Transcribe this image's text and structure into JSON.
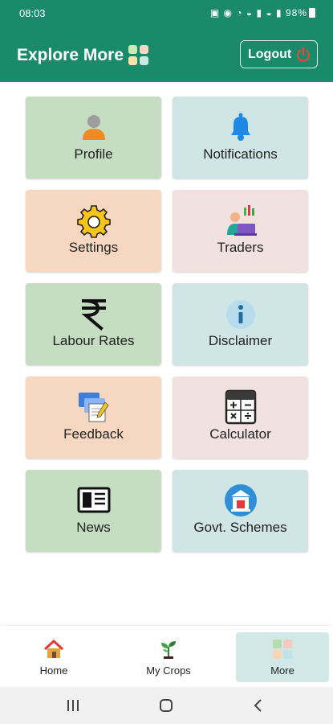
{
  "status": {
    "time": "08:03",
    "battery": "98%"
  },
  "header": {
    "title": "Explore More",
    "logout_label": "Logout"
  },
  "menu": [
    {
      "label": "Profile",
      "icon": "profile-icon"
    },
    {
      "label": "Notifications",
      "icon": "bell-icon"
    },
    {
      "label": "Settings",
      "icon": "gear-icon"
    },
    {
      "label": "Traders",
      "icon": "traders-icon"
    },
    {
      "label": "Labour Rates",
      "icon": "rupee-icon"
    },
    {
      "label": "Disclaimer",
      "icon": "info-icon"
    },
    {
      "label": "Feedback",
      "icon": "feedback-icon"
    },
    {
      "label": "Calculator",
      "icon": "calculator-icon"
    },
    {
      "label": "News",
      "icon": "newspaper-icon"
    },
    {
      "label": "Govt. Schemes",
      "icon": "government-icon"
    }
  ],
  "bottom_nav": [
    {
      "label": "Home",
      "icon": "home-icon"
    },
    {
      "label": "My Crops",
      "icon": "plant-icon"
    },
    {
      "label": "More",
      "icon": "grid-icon",
      "active": true
    }
  ],
  "colors": {
    "header": "#1b8a6b",
    "green_card": "#c5dec1",
    "blue_card": "#cfe5e6",
    "peach_card": "#f6d8c2",
    "pink_card": "#f1e2e1"
  }
}
